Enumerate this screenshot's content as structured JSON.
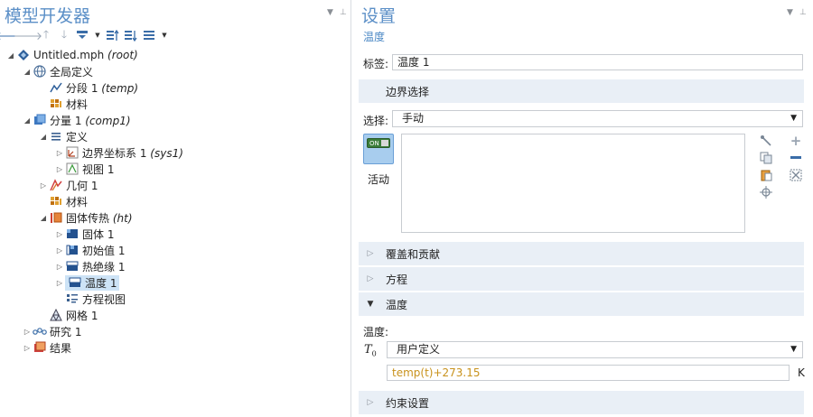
{
  "left": {
    "title": "模型开发器",
    "tree": [
      {
        "label": "Untitled.mph",
        "tag": "(root)",
        "icon": "model-icon"
      },
      {
        "label": "全局定义",
        "tag": "",
        "icon": "globe-icon"
      },
      {
        "label": "分段 1",
        "tag": "(temp)",
        "icon": "piecewise-icon"
      },
      {
        "label": "材料",
        "tag": "",
        "icon": "materials-icon"
      },
      {
        "label": "分量 1",
        "tag": "(comp1)",
        "icon": "component-icon"
      },
      {
        "label": "定义",
        "tag": "",
        "icon": "definitions-icon"
      },
      {
        "label": "边界坐标系 1",
        "tag": "(sys1)",
        "icon": "coordinate-system-icon"
      },
      {
        "label": "视图 1",
        "tag": "",
        "icon": "view-icon"
      },
      {
        "label": "几何 1",
        "tag": "",
        "icon": "geometry-icon"
      },
      {
        "label": "材料",
        "tag": "",
        "icon": "materials-icon"
      },
      {
        "label": "固体传热",
        "tag": "(ht)",
        "icon": "heat-transfer-icon"
      },
      {
        "label": "固体 1",
        "tag": "",
        "icon": "solid-icon"
      },
      {
        "label": "初始值 1",
        "tag": "",
        "icon": "initial-values-icon"
      },
      {
        "label": "热绝缘 1",
        "tag": "",
        "icon": "thermal-insulation-icon"
      },
      {
        "label": "温度 1",
        "tag": "",
        "icon": "temperature-icon"
      },
      {
        "label": "方程视图",
        "tag": "",
        "icon": "equation-view-icon"
      },
      {
        "label": "网格 1",
        "tag": "",
        "icon": "mesh-icon"
      },
      {
        "label": "研究 1",
        "tag": "",
        "icon": "study-icon"
      },
      {
        "label": "结果",
        "tag": "",
        "icon": "results-icon"
      }
    ]
  },
  "right": {
    "title": "设置",
    "subtitle": "温度",
    "label_caption": "标签:",
    "label_value": "温度 1",
    "boundary_selection": "边界选择",
    "selection_caption": "选择:",
    "selection_value": "手动",
    "active_label": "活动",
    "on_text": "ON",
    "sections": {
      "override": "覆盖和贡献",
      "equation": "方程",
      "temperature": "温度",
      "constraint": "约束设置"
    },
    "temperature_caption": "温度:",
    "t0_symbol": "T",
    "t0_sub": "0",
    "t0_option": "用户定义",
    "t0_expression": "temp(t)+273.15",
    "t0_unit": "K"
  },
  "colors": {
    "title_blue": "#5b8fc7",
    "section_bg": "#e9eff6",
    "expression_text": "#c8921c",
    "selected_row": "#cde3f6"
  }
}
